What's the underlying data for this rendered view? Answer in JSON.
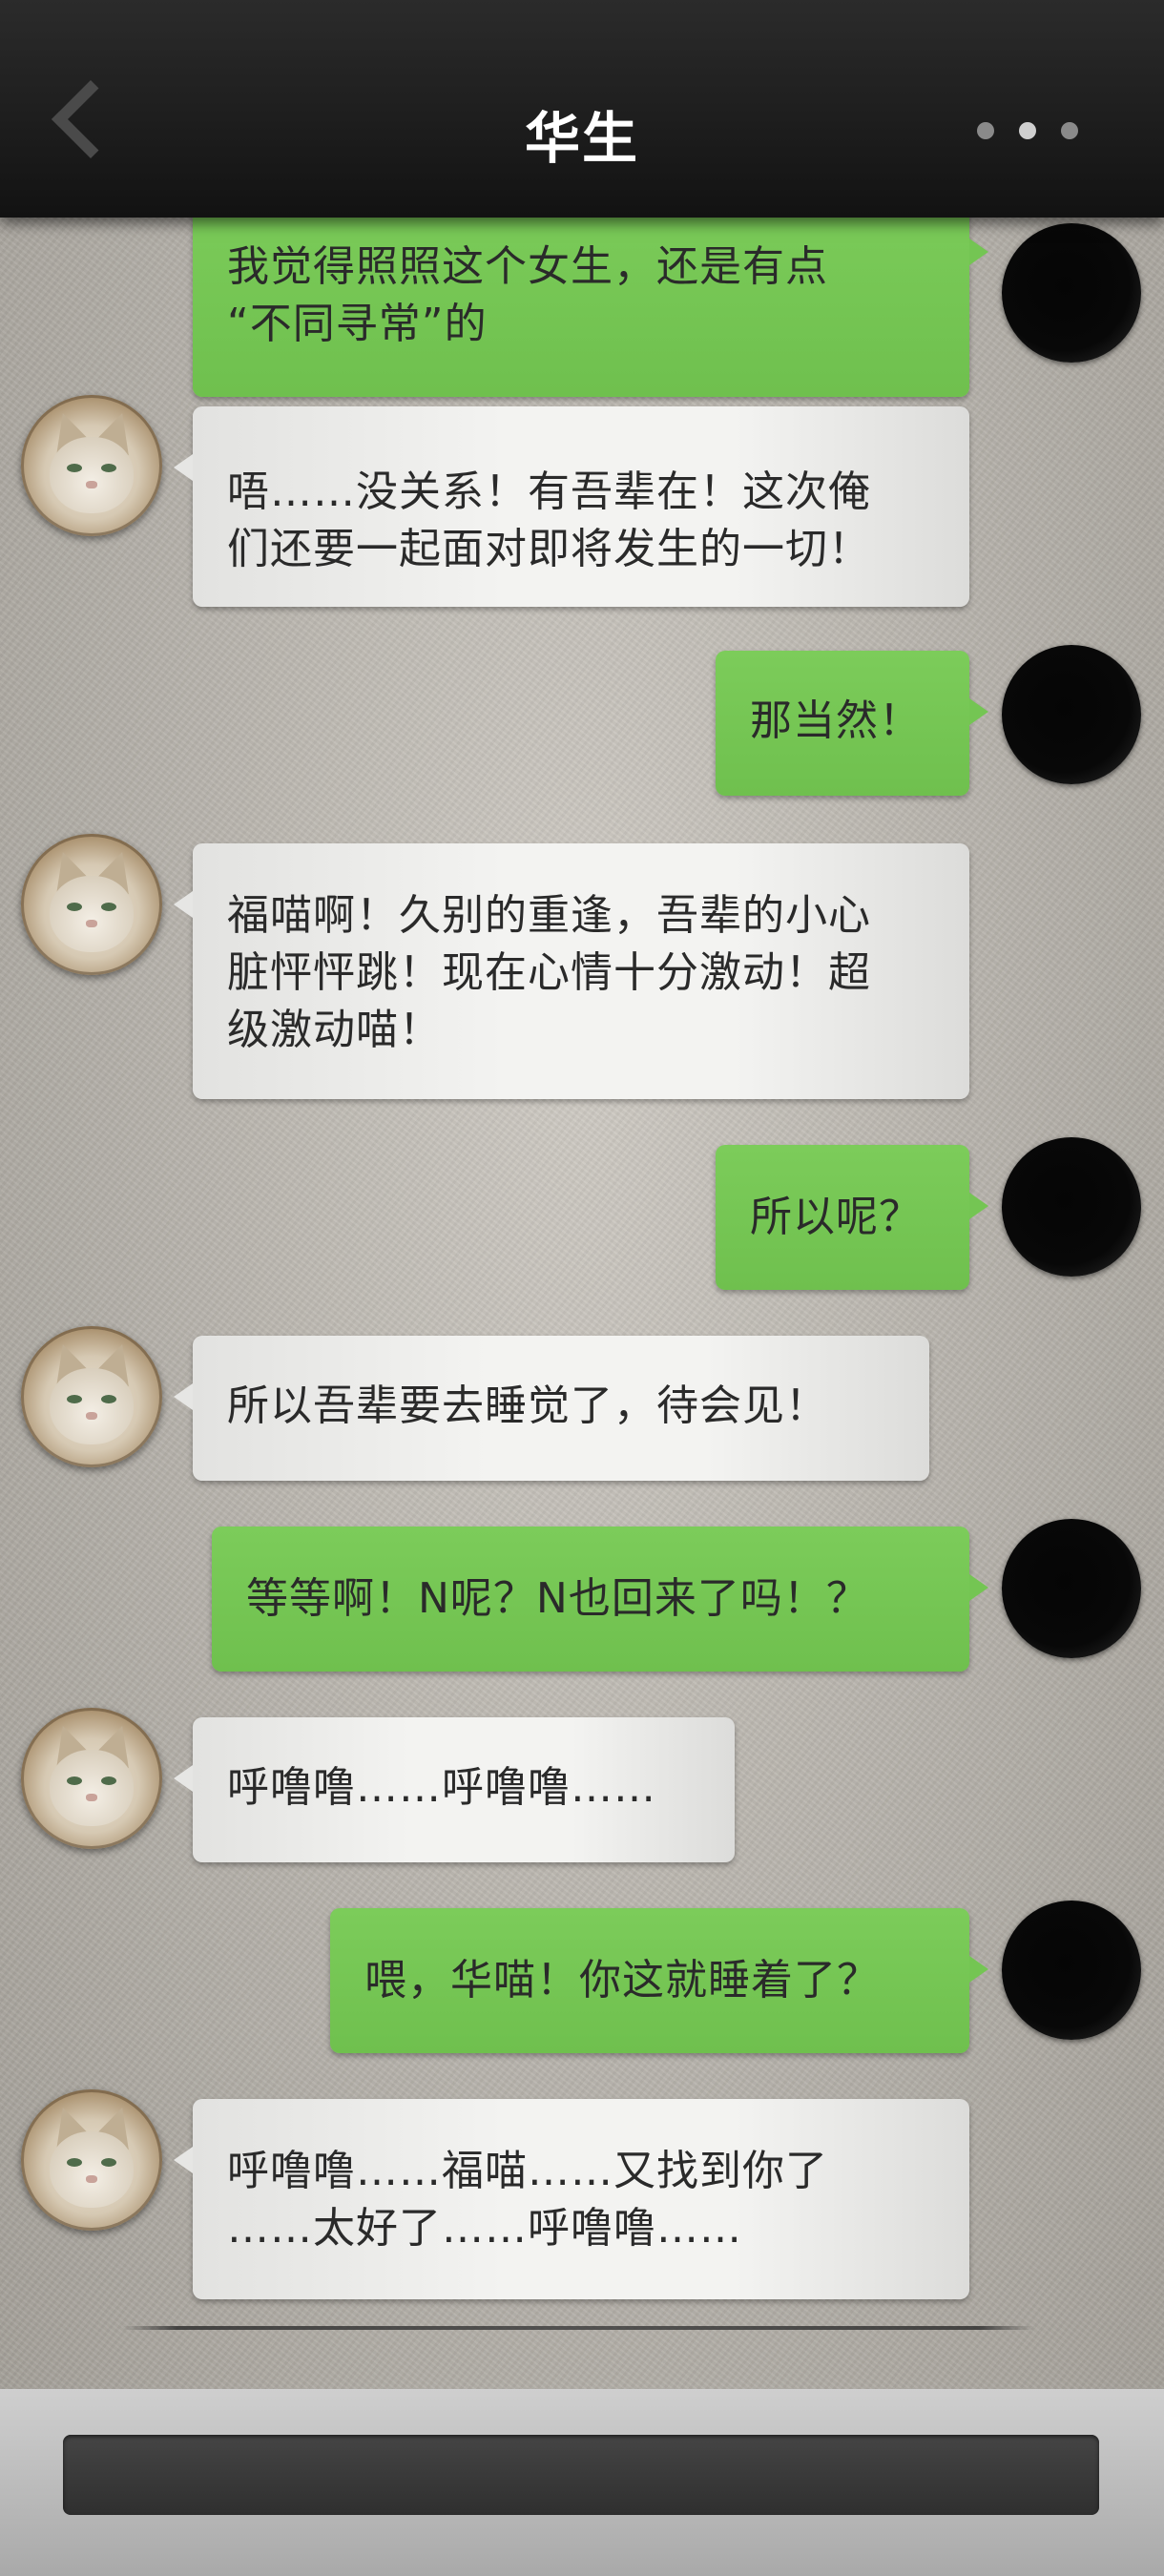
{
  "header": {
    "title": "华生"
  },
  "messages": [
    {
      "sender": "self",
      "lines": [
        "我觉得照照这个女生，还是有点",
        "“不同寻常”的"
      ]
    },
    {
      "sender": "cat",
      "lines": [
        "唔……没关系！有吾辈在！这次俺",
        "们还要一起面对即将发生的一切！"
      ]
    },
    {
      "sender": "self",
      "lines": [
        "那当然！"
      ]
    },
    {
      "sender": "cat",
      "lines": [
        "福喵啊！久别的重逢，吾辈的小心",
        "脏怦怦跳！现在心情十分激动！超",
        "级激动喵！"
      ]
    },
    {
      "sender": "self",
      "lines": [
        "所以呢？"
      ]
    },
    {
      "sender": "cat",
      "lines": [
        "所以吾辈要去睡觉了，待会见！"
      ]
    },
    {
      "sender": "self",
      "lines": [
        "等等啊！N呢？N也回来了吗！？"
      ]
    },
    {
      "sender": "cat",
      "lines": [
        "呼噜噜……呼噜噜……"
      ]
    },
    {
      "sender": "self",
      "lines": [
        "喂，华喵！你这就睡着了？"
      ]
    },
    {
      "sender": "cat",
      "lines": [
        "呼噜噜……福喵……又找到你了",
        "……太好了……呼噜噜……"
      ]
    }
  ],
  "input": {
    "placeholder": ""
  },
  "colors": {
    "self_bubble": "#74c553",
    "cat_bubble": "#f1f1ef",
    "header_bg": "#1f1f1f"
  },
  "icons": {
    "back": "chevron-left-icon",
    "more": "more-dots-icon"
  }
}
